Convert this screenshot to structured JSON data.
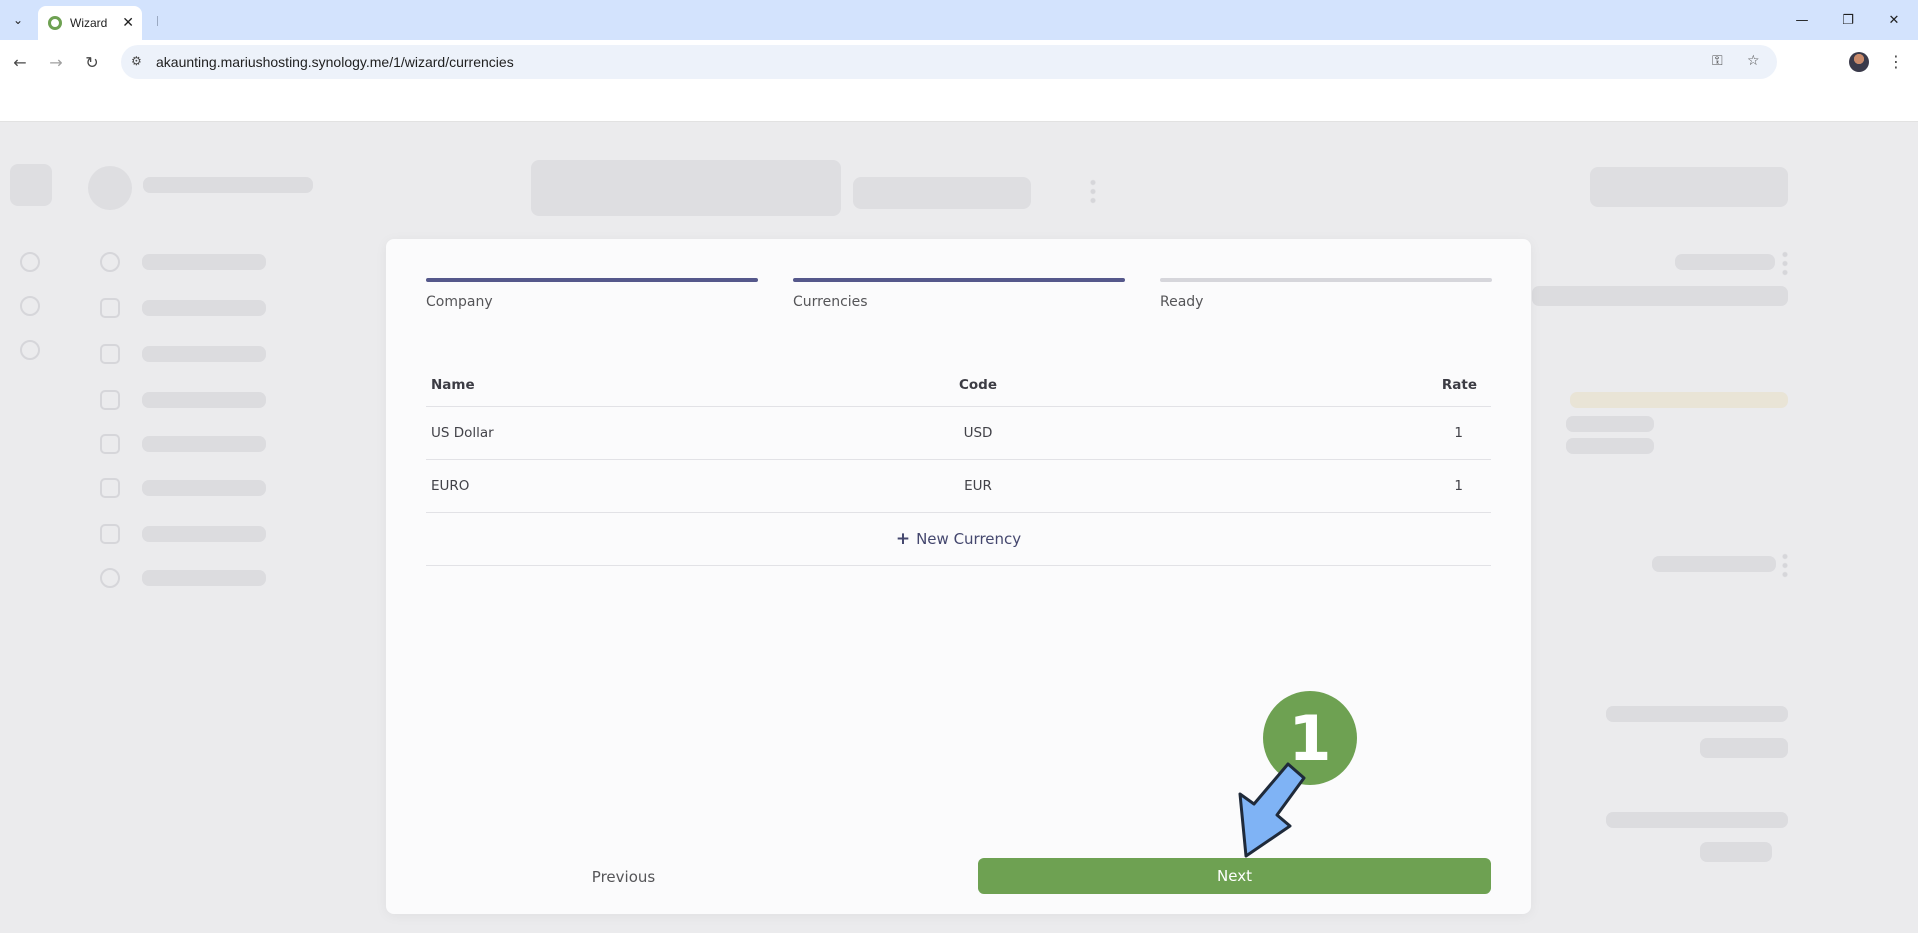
{
  "browser": {
    "tab_title": "Wizard",
    "url": "akaunting.mariushosting.synology.me/1/wizard/currencies"
  },
  "wizard": {
    "steps": [
      {
        "label": "Company",
        "state": "done"
      },
      {
        "label": "Currencies",
        "state": "active"
      },
      {
        "label": "Ready",
        "state": "pending"
      }
    ],
    "table": {
      "headers": {
        "name": "Name",
        "code": "Code",
        "rate": "Rate"
      },
      "rows": [
        {
          "name": "US Dollar",
          "code": "USD",
          "rate": "1"
        },
        {
          "name": "EURO",
          "code": "EUR",
          "rate": "1"
        }
      ]
    },
    "add_currency": {
      "icon": "plus-icon",
      "label": "New Currency"
    },
    "buttons": {
      "previous": "Previous",
      "next": "Next"
    }
  },
  "annotation": {
    "step_number": "1"
  },
  "colors": {
    "accent_green": "#6ea152",
    "step_active": "#55588b",
    "step_inactive": "#d6d6db",
    "tabbar": "#d3e3fd"
  }
}
